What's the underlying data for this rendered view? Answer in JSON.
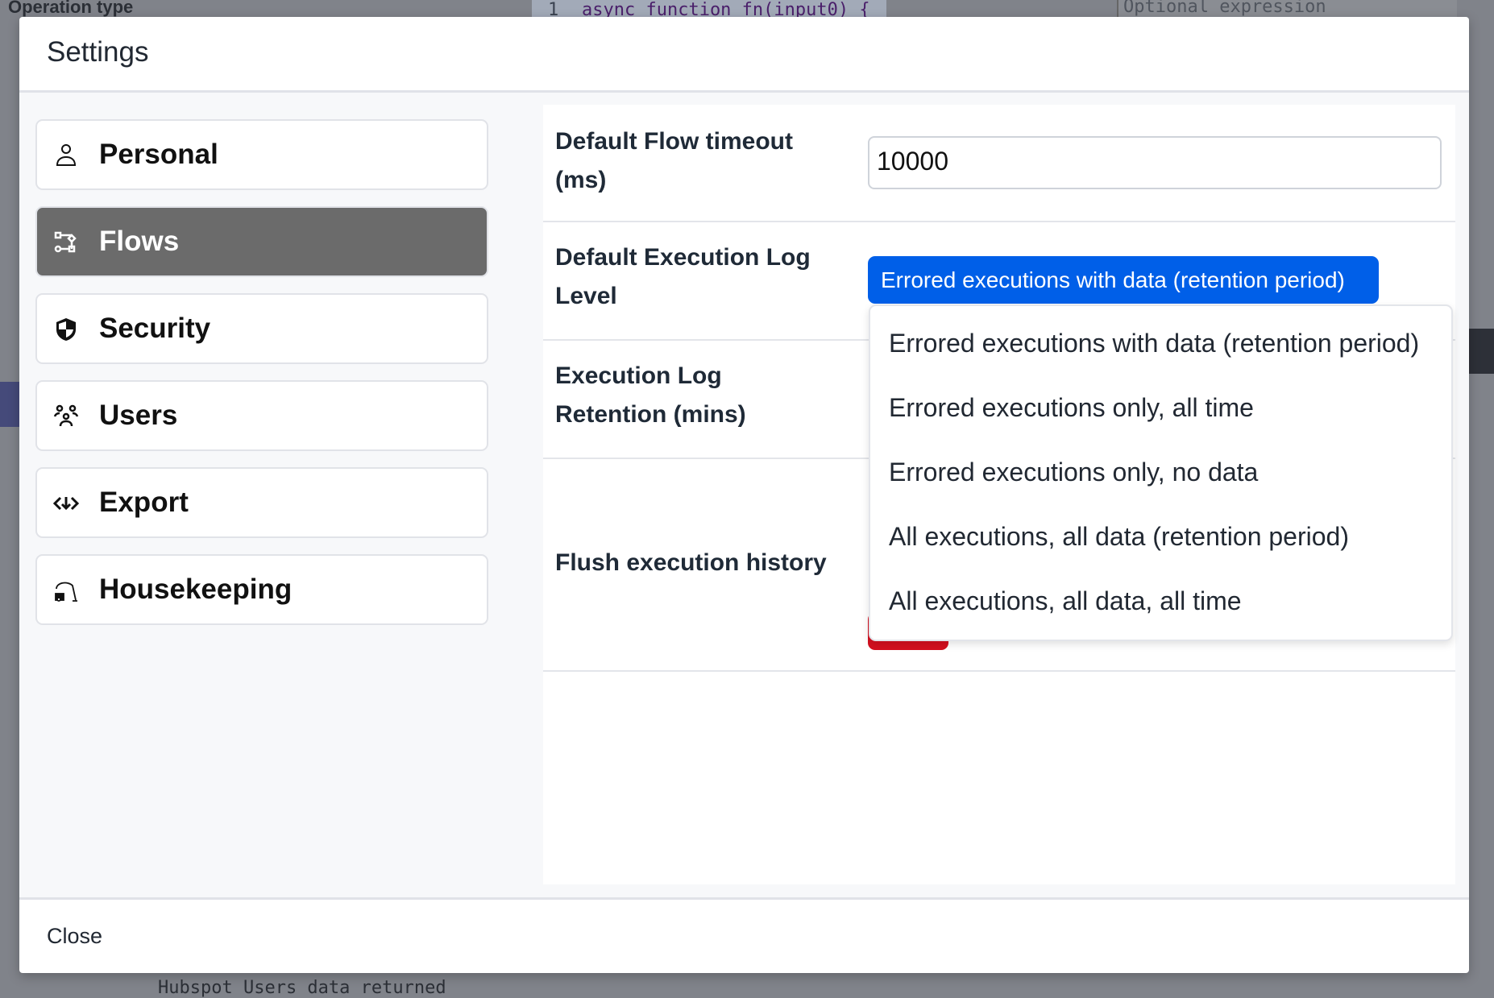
{
  "background": {
    "operation_type_label": "Operation type",
    "code_line_number": "1",
    "code_line": "async function fn(input0) {",
    "expression_placeholder": "Optional expression",
    "log_text": "Hubspot Users data returned"
  },
  "modal": {
    "title": "Settings",
    "close_label": "Close"
  },
  "sidebar": {
    "items": [
      {
        "label": "Personal",
        "icon": "person-icon",
        "active": false
      },
      {
        "label": "Flows",
        "icon": "flow-icon",
        "active": true
      },
      {
        "label": "Security",
        "icon": "shield-icon",
        "active": false
      },
      {
        "label": "Users",
        "icon": "users-icon",
        "active": false
      },
      {
        "label": "Export",
        "icon": "export-icon",
        "active": false
      },
      {
        "label": "Housekeeping",
        "icon": "vacuum-icon",
        "active": false
      }
    ]
  },
  "settings": {
    "flow_timeout": {
      "label": "Default Flow timeout (ms)",
      "value": "10000"
    },
    "log_level": {
      "label": "Default Execution Log Level",
      "selected": "Errored executions with data (retention period)",
      "options": [
        "Errored executions with data (retention period)",
        "Errored executions only, all time",
        "Errored executions only, no data",
        "All executions, all data (retention period)",
        "All executions, all data, all time"
      ]
    },
    "retention": {
      "label": "Execution Log Retention (mins)"
    },
    "flush": {
      "label": "Flush execution history"
    }
  },
  "colors": {
    "accent": "#005fe8",
    "danger": "#d4101f",
    "active_nav": "#6b6b6b"
  }
}
